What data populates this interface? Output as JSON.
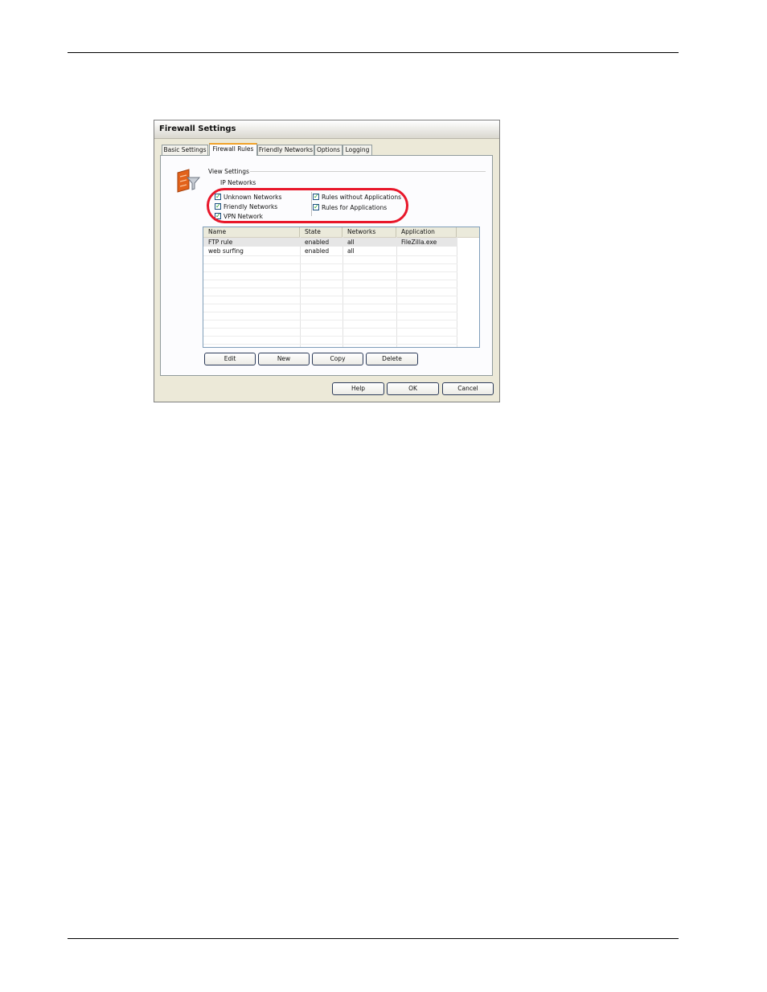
{
  "dialog": {
    "title": "Firewall Settings",
    "tabs": [
      {
        "label": "Basic Settings",
        "active": false
      },
      {
        "label": "Firewall Rules",
        "active": true
      },
      {
        "label": "Friendly Networks",
        "active": false
      },
      {
        "label": "Options",
        "active": false
      },
      {
        "label": "Logging",
        "active": false
      }
    ],
    "view_settings_label": "View Settings",
    "ip_networks_label": "IP Networks",
    "checkboxes": {
      "unknown_networks": {
        "label": "Unknown Networks",
        "checked": true
      },
      "friendly_networks": {
        "label": "Friendly Networks",
        "checked": true
      },
      "vpn_network": {
        "label": "VPN Network",
        "checked": true
      },
      "rules_without_apps": {
        "label": "Rules without Applications",
        "checked": true
      },
      "rules_for_apps": {
        "label": "Rules for Applications",
        "checked": true
      }
    },
    "columns": [
      "Name",
      "State",
      "Networks",
      "Application"
    ],
    "rows": [
      {
        "name": "FTP rule",
        "state": "enabled",
        "networks": "all",
        "application": "FileZilla.exe",
        "selected": true
      },
      {
        "name": "web surfing",
        "state": "enabled",
        "networks": "all",
        "application": "",
        "selected": false
      }
    ],
    "list_buttons": {
      "edit": "Edit",
      "new": "New",
      "copy": "Copy",
      "delete": "Delete"
    },
    "footer_buttons": {
      "help": "Help",
      "ok": "OK",
      "cancel": "Cancel"
    }
  },
  "colors": {
    "highlight": "#e8172a",
    "active_tab_accent": "#f0a22a",
    "checkmark": "#21a121"
  },
  "icons": {
    "view_settings": "firewall-filter-icon",
    "checkbox": "check-icon"
  }
}
